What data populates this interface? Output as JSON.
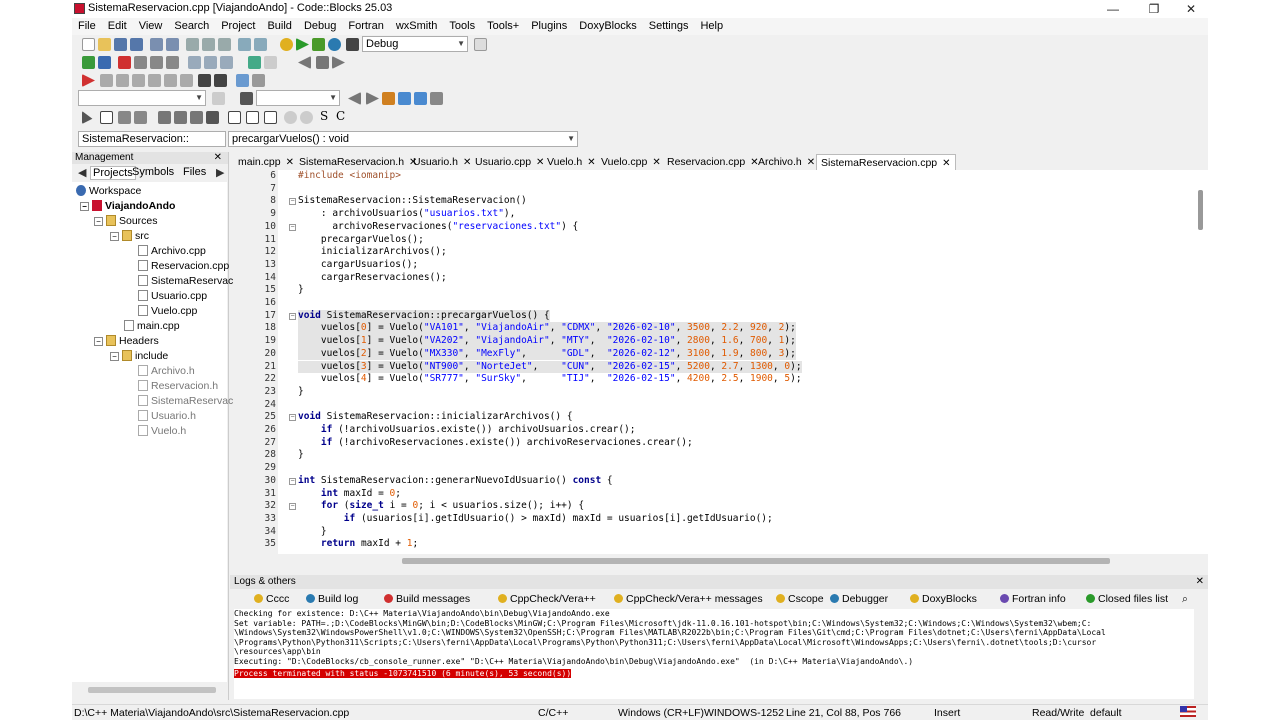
{
  "window": {
    "title": "SistemaReservacion.cpp [ViajandoAndo] - Code::Blocks 25.03"
  },
  "menu": [
    "File",
    "Edit",
    "View",
    "Search",
    "Project",
    "Build",
    "Debug",
    "Fortran",
    "wxSmith",
    "Tools",
    "Tools+",
    "Plugins",
    "DoxyBlocks",
    "Settings",
    "Help"
  ],
  "toolbar": {
    "build_target": "Debug"
  },
  "scope": {
    "class": "SistemaReservacion::",
    "function": "precargarVuelos() : void"
  },
  "management": {
    "title": "Management",
    "tabs": [
      "Projects",
      "Symbols",
      "Files"
    ],
    "tree": {
      "workspace": "Workspace",
      "project": "ViajandoAndo",
      "sources": "Sources",
      "src": "src",
      "source_files": [
        "Archivo.cpp",
        "Reservacion.cpp",
        "SistemaReservac",
        "Usuario.cpp",
        "Vuelo.cpp"
      ],
      "main": "main.cpp",
      "headers": "Headers",
      "include": "include",
      "header_files": [
        "Archivo.h",
        "Reservacion.h",
        "SistemaReservac",
        "Usuario.h",
        "Vuelo.h"
      ]
    }
  },
  "editor": {
    "tabs": [
      "main.cpp",
      "SistemaReservacion.h",
      "Usuario.h",
      "Usuario.cpp",
      "Vuelo.h",
      "Vuelo.cpp",
      "Reservacion.cpp",
      "Archivo.h",
      "SistemaReservacion.cpp"
    ],
    "active_tab": "SistemaReservacion.cpp",
    "lines": [
      {
        "n": "6",
        "t": "#include <iomanip>"
      },
      {
        "n": "7",
        "t": ""
      },
      {
        "n": "8",
        "t": "SistemaReservacion::SistemaReservacion()"
      },
      {
        "n": "9",
        "t": "    : archivoUsuarios(\"usuarios.txt\"),"
      },
      {
        "n": "10",
        "t": "      archivoReservaciones(\"reservaciones.txt\") {"
      },
      {
        "n": "11",
        "t": "    precargarVuelos();"
      },
      {
        "n": "12",
        "t": "    inicializarArchivos();"
      },
      {
        "n": "13",
        "t": "    cargarUsuarios();"
      },
      {
        "n": "14",
        "t": "    cargarReservaciones();"
      },
      {
        "n": "15",
        "t": "}"
      },
      {
        "n": "16",
        "t": ""
      },
      {
        "n": "17",
        "t": "void SistemaReservacion::precargarVuelos() {"
      },
      {
        "n": "18",
        "t": "    vuelos[0] = Vuelo(\"VA101\", \"ViajandoAir\", \"CDMX\", \"2026-02-10\", 3500, 2.2, 920, 2);"
      },
      {
        "n": "19",
        "t": "    vuelos[1] = Vuelo(\"VA202\", \"ViajandoAir\", \"MTY\",  \"2026-02-10\", 2800, 1.6, 700, 1);"
      },
      {
        "n": "20",
        "t": "    vuelos[2] = Vuelo(\"MX330\", \"MexFly\",      \"GDL\",  \"2026-02-12\", 3100, 1.9, 800, 3);"
      },
      {
        "n": "21",
        "t": "    vuelos[3] = Vuelo(\"NT900\", \"NorteJet\",    \"CUN\",  \"2026-02-15\", 5200, 2.7, 1300, 0);"
      },
      {
        "n": "22",
        "t": "    vuelos[4] = Vuelo(\"SR777\", \"SurSky\",      \"TIJ\",  \"2026-02-15\", 4200, 2.5, 1900, 5);"
      },
      {
        "n": "23",
        "t": "}"
      },
      {
        "n": "24",
        "t": ""
      },
      {
        "n": "25",
        "t": "void SistemaReservacion::inicializarArchivos() {"
      },
      {
        "n": "26",
        "t": "    if (!archivoUsuarios.existe()) archivoUsuarios.crear();"
      },
      {
        "n": "27",
        "t": "    if (!archivoReservaciones.existe()) archivoReservaciones.crear();"
      },
      {
        "n": "28",
        "t": "}"
      },
      {
        "n": "29",
        "t": ""
      },
      {
        "n": "30",
        "t": "int SistemaReservacion::generarNuevoIdUsuario() const {"
      },
      {
        "n": "31",
        "t": "    int maxId = 0;"
      },
      {
        "n": "32",
        "t": "    for (size_t i = 0; i < usuarios.size(); i++) {"
      },
      {
        "n": "33",
        "t": "        if (usuarios[i].getIdUsuario() > maxId) maxId = usuarios[i].getIdUsuario();"
      },
      {
        "n": "34",
        "t": "    }"
      },
      {
        "n": "35",
        "t": "    return maxId + 1;"
      }
    ]
  },
  "logs": {
    "title": "Logs & others",
    "tabs": [
      "Cccc",
      "Build log",
      "Build messages",
      "CppCheck/Vera++",
      "CppCheck/Vera++ messages",
      "Cscope",
      "Debugger",
      "DoxyBlocks",
      "Fortran info",
      "Closed files list"
    ],
    "lines": [
      "Checking for existence: D:\\C++ Materia\\ViajandoAndo\\bin\\Debug\\ViajandoAndo.exe",
      "Set variable: PATH=.;D:\\CodeBlocks\\MinGW\\bin;D:\\CodeBlocks\\MinGW;C:\\Program Files\\Microsoft\\jdk-11.0.16.101-hotspot\\bin;C:\\Windows\\System32;C:\\Windows;C:\\Windows\\System32\\wbem;C:",
      "\\Windows\\System32\\WindowsPowerShell\\v1.0;C:\\WINDOWS\\System32\\OpenSSH;C:\\Program Files\\MATLAB\\R2022b\\bin;C:\\Program Files\\Git\\cmd;C:\\Program Files\\dotnet;C:\\Users\\ferni\\AppData\\Local",
      "\\Programs\\Python\\Python311\\Scripts;C:\\Users\\ferni\\AppData\\Local\\Programs\\Python\\Python311;C:\\Users\\ferni\\AppData\\Local\\Microsoft\\WindowsApps;C:\\Users\\ferni\\.dotnet\\tools;D:\\cursor",
      "\\resources\\app\\bin",
      "Executing: \"D:\\CodeBlocks/cb_console_runner.exe\" \"D:\\C++ Materia\\ViajandoAndo\\bin\\Debug\\ViajandoAndo.exe\"  (in D:\\C++ Materia\\ViajandoAndo\\.)"
    ],
    "error_line": "Process terminated with status -1073741510 (6 minute(s), 53 second(s))"
  },
  "status": {
    "path": "D:\\C++ Materia\\ViajandoAndo\\src\\SistemaReservacion.cpp",
    "lang": "C/C++",
    "eol": "Windows (CR+LF)",
    "encoding": "WINDOWS-1252",
    "position": "Line 21, Col 88, Pos 766",
    "mode": "Insert",
    "access": "Read/Write",
    "profile": "default"
  },
  "colors": {
    "accent": "#d40000",
    "keyword": "#00008b",
    "string": "#0000ff",
    "preproc": "#8b0000"
  }
}
